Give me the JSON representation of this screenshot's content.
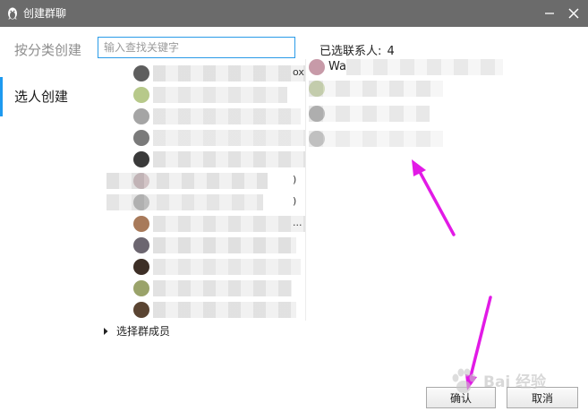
{
  "window": {
    "title": "创建群聊"
  },
  "sidenav": {
    "items": [
      {
        "label": "按分类创建"
      },
      {
        "label": "选人创建"
      }
    ]
  },
  "search": {
    "placeholder": "输入查找关键字"
  },
  "contacts": {
    "rows": [
      {
        "avatar_color": "#5e5e5e",
        "name_color": "#c9c9c9",
        "suffix": "ox..."
      },
      {
        "avatar_color": "#b7c98a",
        "name_color": "#d2d2d2",
        "suffix": ""
      },
      {
        "avatar_color": "#a5a5a5",
        "name_color": "#cfcfcf",
        "suffix": ""
      },
      {
        "avatar_color": "#7a7a7a",
        "name_color": "#d4d4d4",
        "suffix": ""
      },
      {
        "avatar_color": "#3a3a3a",
        "name_color": "#cacaca",
        "suffix": ""
      },
      {
        "avatar_color": "#b99aa0",
        "name_color": "#c8c8c8",
        "suffix": ")"
      },
      {
        "avatar_color": "#8a8a8a",
        "name_color": "#d0d0d0",
        "suffix": ")"
      },
      {
        "avatar_color": "#a87a5a",
        "name_color": "#cccccc",
        "suffix": "..."
      },
      {
        "avatar_color": "#6c6670",
        "name_color": "#c6c6c6",
        "suffix": ""
      },
      {
        "avatar_color": "#3d2f26",
        "name_color": "#d1d1d1",
        "suffix": ""
      },
      {
        "avatar_color": "#9aa36a",
        "name_color": "#cbcbcb",
        "suffix": ""
      },
      {
        "avatar_color": "#5a4432",
        "name_color": "#c9c9c9",
        "suffix": ""
      }
    ]
  },
  "selected": {
    "header_label": "已选联系人:",
    "count": "4",
    "items": [
      {
        "name": "Wa",
        "avatar_color": "#c79aa8",
        "blur_color": "#d3d3d3"
      },
      {
        "name": "",
        "avatar_color": "#b7c98a",
        "blur_color": "#cfcfcf"
      },
      {
        "name": "",
        "avatar_color": "#8a8a8a",
        "blur_color": "#d1d1d1"
      },
      {
        "name": "",
        "avatar_color": "#a8a8a8",
        "blur_color": "#d8d8d8"
      }
    ]
  },
  "members_toggle": {
    "label": "选择群成员"
  },
  "buttons": {
    "confirm": "确认",
    "cancel": "取消"
  },
  "annotations": {
    "arrow_color": "#e21ae6"
  },
  "watermark": {
    "text": "Bai 经验"
  }
}
